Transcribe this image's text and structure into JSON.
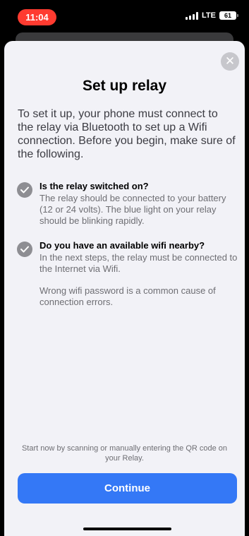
{
  "status_bar": {
    "time": "11:04",
    "network": "LTE",
    "battery": "61"
  },
  "sheet": {
    "title": "Set up relay",
    "intro": "To set it up, your phone must connect to the relay via Bluetooth to set up a Wifi connection. Before you begin, make sure of the following.",
    "items": [
      {
        "heading": "Is the relay switched on?",
        "body": "The relay should be connected to your battery (12 or 24 volts). The blue light on your relay should be blinking rapidly."
      },
      {
        "heading": "Do you have an available wifi nearby?",
        "body": "In the next steps, the relay must be connected to the Internet via Wifi.",
        "note": "Wrong wifi password is a common cause of connection errors."
      }
    ],
    "footer": "Start now by scanning or manually entering the QR code on your Relay.",
    "continue_label": "Continue",
    "close_icon": "close-icon"
  },
  "colors": {
    "accent": "#3478f6",
    "time_pill": "#ff3b30",
    "check": "#8e8e93"
  }
}
